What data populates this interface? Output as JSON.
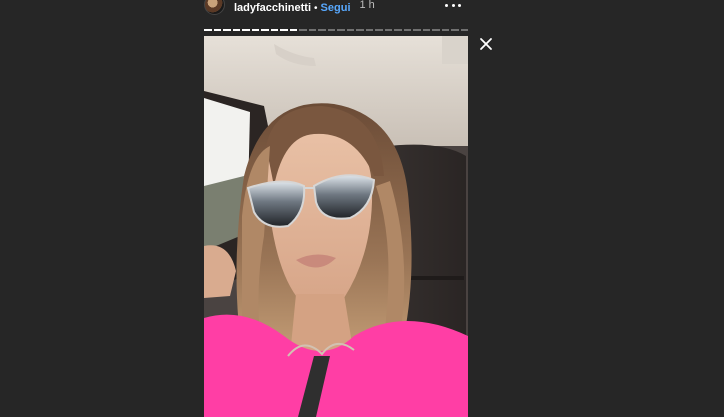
{
  "header": {
    "username": "ladyfacchinetti",
    "separator": "•",
    "follow_label": "Segui",
    "time": "1 h"
  },
  "icons": {
    "avatar": "profile-avatar",
    "more": "more-horizontal-icon",
    "close": "close-icon"
  },
  "story": {
    "segments_total": 28,
    "segments_viewed": 10
  },
  "colors": {
    "background": "#262626",
    "follow": "#58a9ff",
    "shirt": "#ff3ea5"
  }
}
